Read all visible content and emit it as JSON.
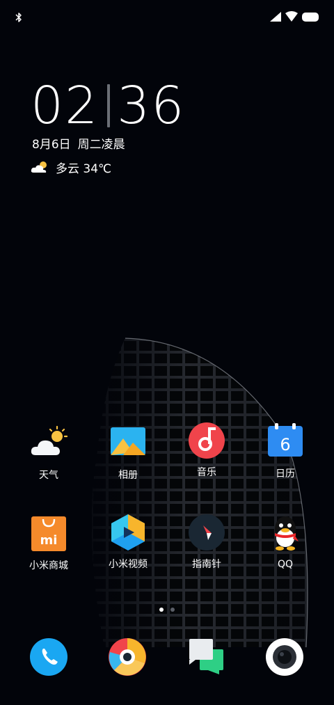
{
  "status_bar": {
    "icons": [
      "bluetooth-icon",
      "signal-icon",
      "wifi-icon",
      "battery-icon"
    ]
  },
  "clock": {
    "hours": "02",
    "minutes": "36"
  },
  "date": {
    "day": "8月6日",
    "weekday": "周二凌晨"
  },
  "weather": {
    "icon": "partly-cloudy-icon",
    "text": "多云 34℃"
  },
  "apps_row1": [
    {
      "label": "天气",
      "icon": "weather-icon"
    },
    {
      "label": "相册",
      "icon": "gallery-icon"
    },
    {
      "label": "音乐",
      "icon": "music-icon"
    },
    {
      "label": "日历",
      "icon": "calendar-icon",
      "badge": "6"
    }
  ],
  "apps_row2": [
    {
      "label": "小米商城",
      "icon": "mi-store-icon",
      "badge": "mi"
    },
    {
      "label": "小米视频",
      "icon": "mi-video-icon"
    },
    {
      "label": "指南针",
      "icon": "compass-icon"
    },
    {
      "label": "QQ",
      "icon": "qq-icon"
    }
  ],
  "page_indicator": {
    "pages": 2,
    "current": 1
  },
  "dock": [
    {
      "icon": "phone-icon"
    },
    {
      "icon": "browser-icon"
    },
    {
      "icon": "messages-icon"
    },
    {
      "icon": "camera-icon"
    }
  ],
  "colors": {
    "background": "#02040a",
    "phone": "#1aa7f2",
    "music": "#f0444b",
    "calendar": "#2e8cf2",
    "mi_store": "#f58a2b",
    "messages": "#2ecf85"
  }
}
